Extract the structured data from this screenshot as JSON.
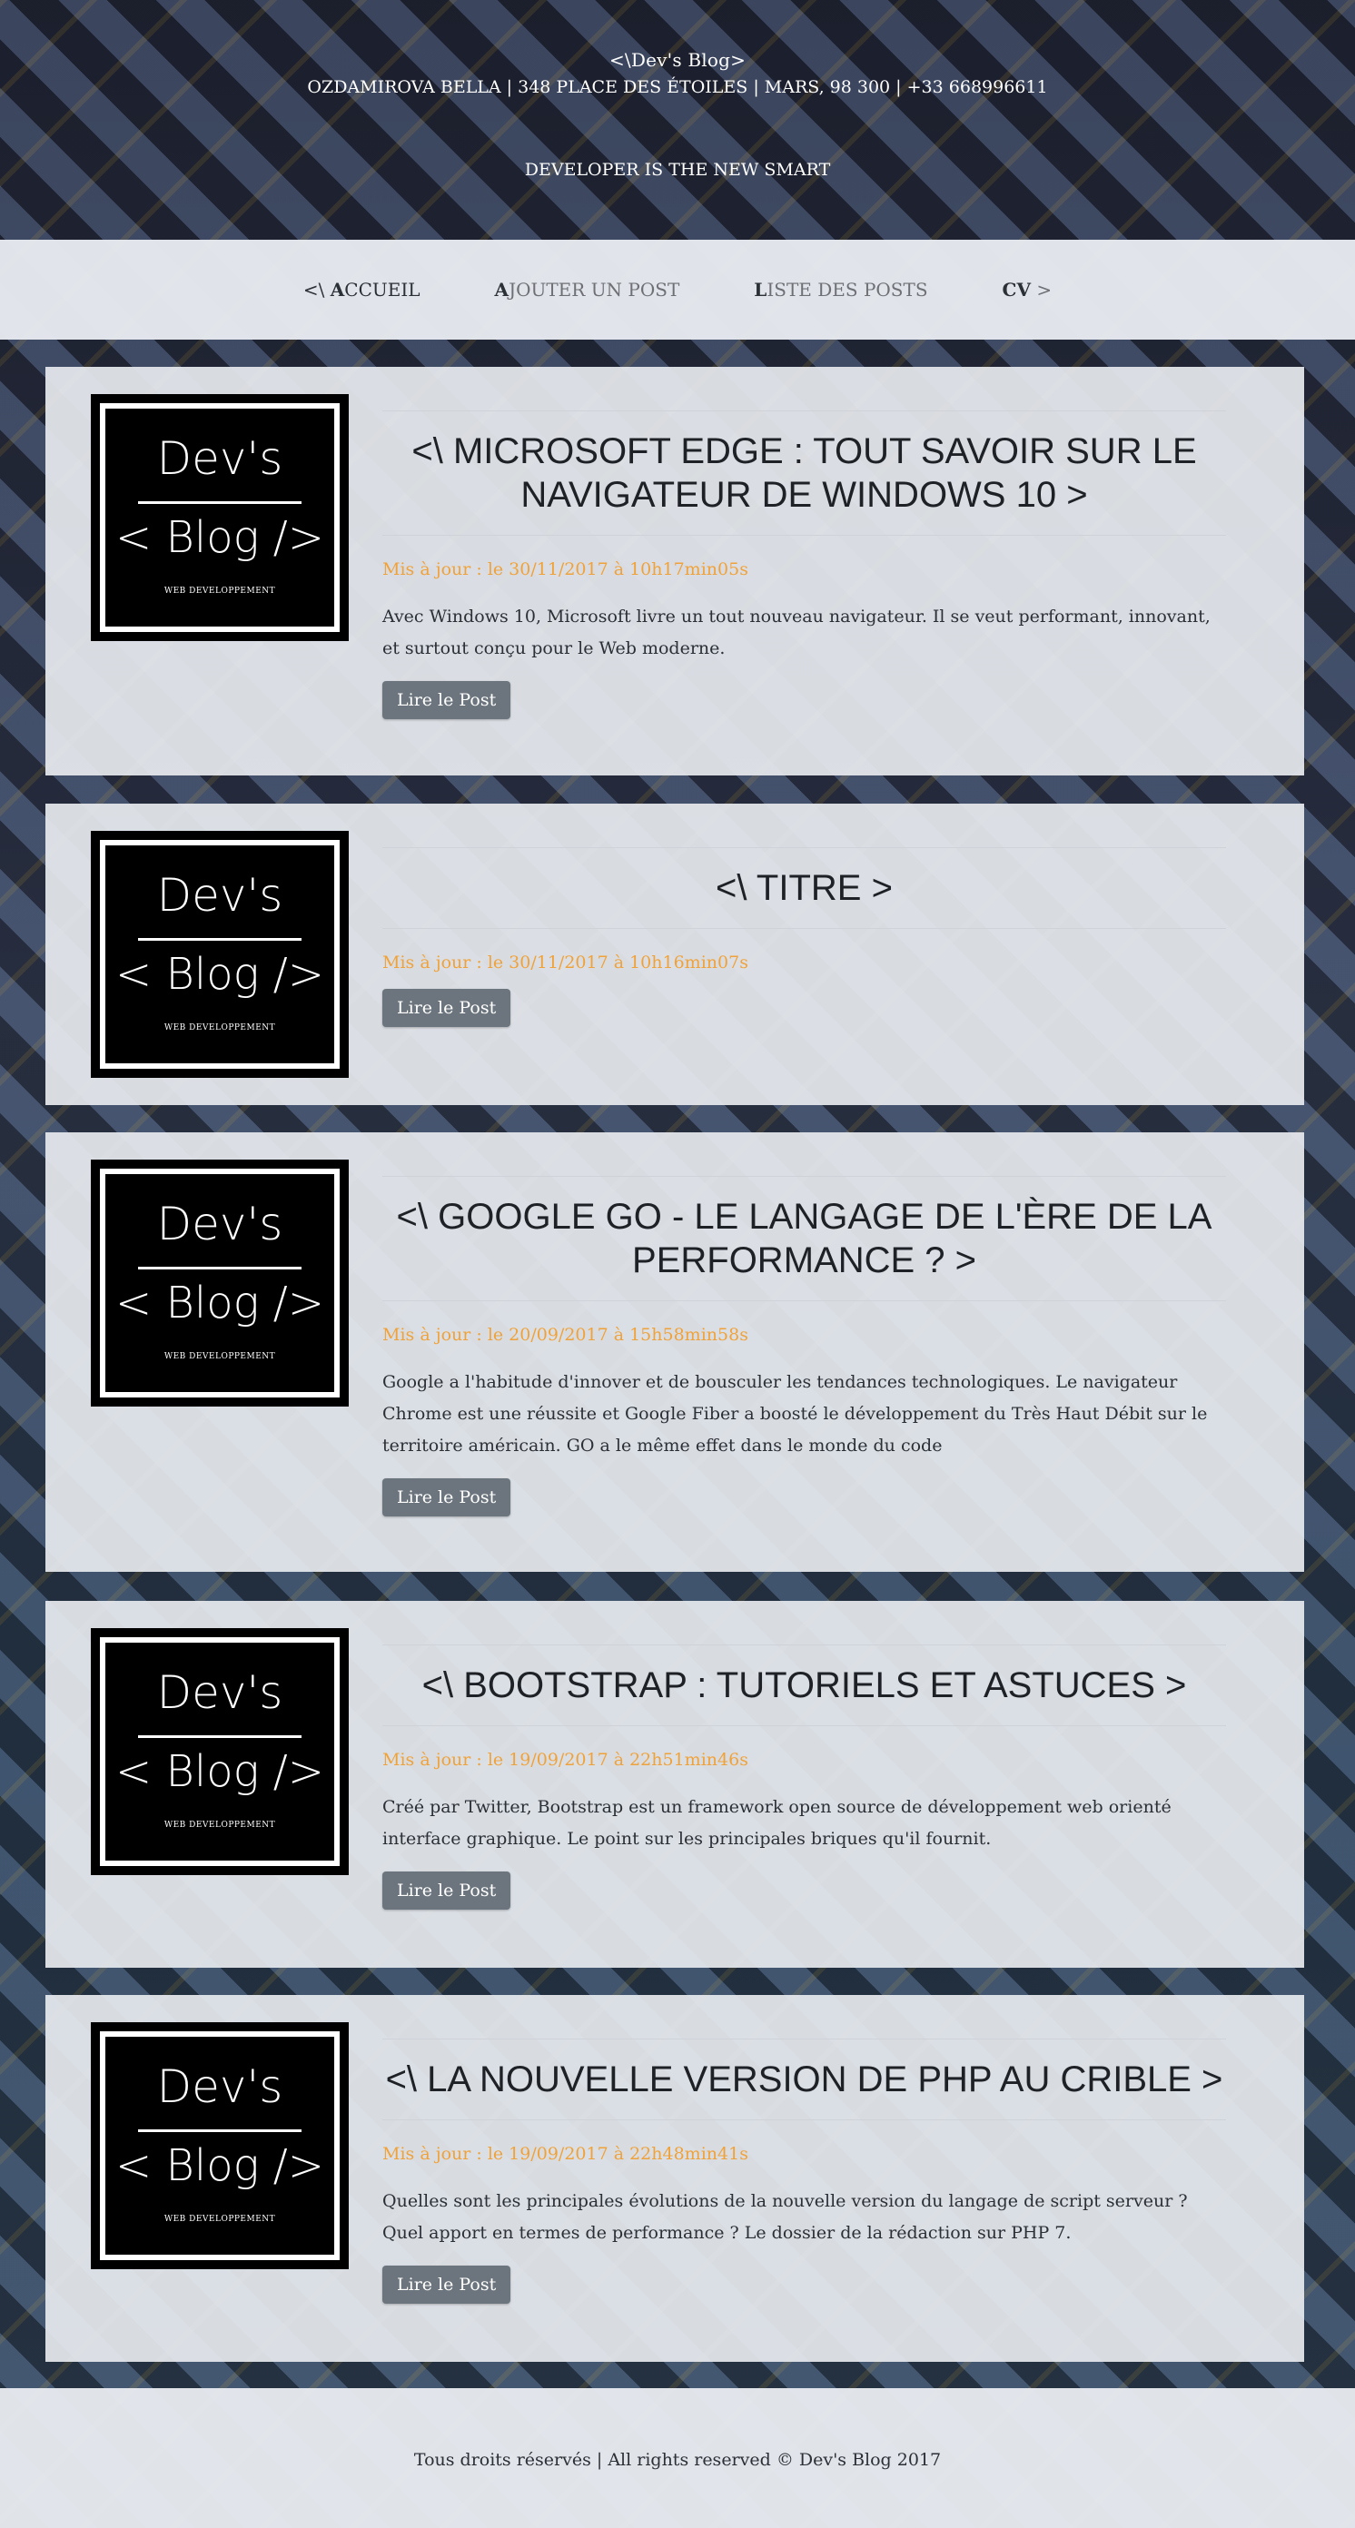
{
  "header": {
    "brand": "<\\Dev's Blog>",
    "address": "OZDAMIROVA BELLA | 348 PLACE DES ÉTOILES | MARS, 98 300 | +33 668996611",
    "tagline": "DEVELOPER IS THE NEW SMART"
  },
  "nav": {
    "items": [
      {
        "prefix": "<\\ ",
        "first": "A",
        "rest": "CCUEIL",
        "active": true
      },
      {
        "prefix": "",
        "first": "A",
        "rest": "JOUTER UN POST",
        "active": false
      },
      {
        "prefix": "",
        "first": "L",
        "rest": "ISTE DES POSTS",
        "active": false
      },
      {
        "prefix": "",
        "first": "CV",
        "rest": " >",
        "active": false
      }
    ]
  },
  "logo": {
    "top": "Dev's",
    "bottom": "< Blog />",
    "sub": "WEB DEVELOPPEMENT"
  },
  "posts": [
    {
      "title": "<\\ Microsoft Edge : tout savoir sur le navigateur de Windows 10 >",
      "date": "Mis à jour : le 30/11/2017 à 10h17min05s",
      "excerpt": "Avec Windows 10, Microsoft livre un tout nouveau navigateur. Il se veut performant, innovant, et surtout conçu pour le Web moderne.",
      "button": "Lire le Post"
    },
    {
      "title": "<\\ TITRE >",
      "date": "Mis à jour : le 30/11/2017 à 10h16min07s",
      "excerpt": "",
      "button": "Lire le Post"
    },
    {
      "title": "<\\ Google Go - le langage de l'ère de la performance ? >",
      "date": "Mis à jour : le 20/09/2017 à 15h58min58s",
      "excerpt": "Google a l'habitude d'innover et de bousculer les tendances technologiques. Le navigateur Chrome est une réussite et Google Fiber a boosté le développement du Très Haut Débit sur le territoire américain. GO a le même effet dans le monde du code",
      "button": "Lire le Post"
    },
    {
      "title": "<\\ Bootstrap : tutoriels et astuces >",
      "date": "Mis à jour : le 19/09/2017 à 22h51min46s",
      "excerpt": "Créé par Twitter, Bootstrap est un framework open source de développement web orienté interface graphique. Le point sur les principales briques qu'il fournit.",
      "button": "Lire le Post"
    },
    {
      "title": "<\\ La nouvelle version de PHP au crible >",
      "date": "Mis à jour : le 19/09/2017 à 22h48min41s",
      "excerpt": "Quelles sont les principales évolutions de la nouvelle version du langage de script serveur ? Quel apport en termes de performance ? Le dossier de la rédaction sur PHP 7.",
      "button": "Lire le Post"
    }
  ],
  "footer": {
    "copyright": "Tous droits réservés | All rights reserved © Dev's Blog 2017"
  },
  "colors": {
    "date_accent": "#f0a23a",
    "button_bg": "#6c757d"
  }
}
